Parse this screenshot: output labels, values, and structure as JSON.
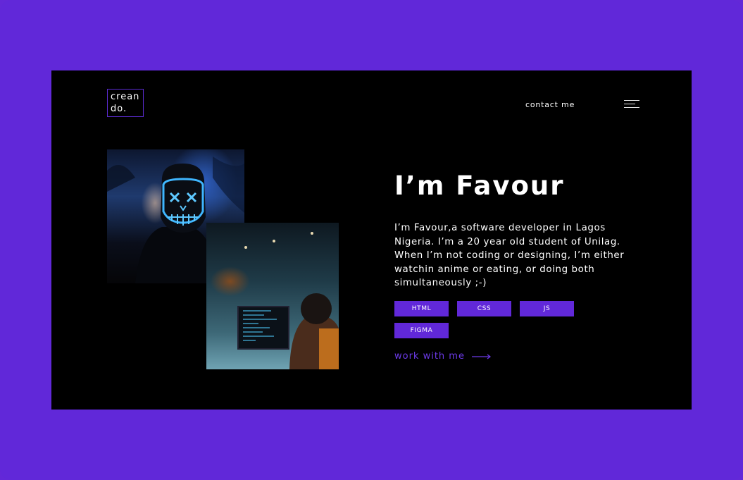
{
  "logo": {
    "line1": "crean",
    "line2": "do."
  },
  "nav": {
    "contact_label": "contact me",
    "menu_icon": "hamburger-menu-icon"
  },
  "hero": {
    "title": "I’m Favour",
    "bio": "I’m Favour,a software developer in Lagos Nigeria. I’m a 20 year old student of Unilag. When I’m not coding or designing, I’m either watchin anime or eating, or doing both simultaneously ;-)",
    "tags": [
      "HTML",
      "CSS",
      "JS",
      "FIGMA"
    ],
    "cta_label": "work with me"
  },
  "colors": {
    "background": "#6128d9",
    "frame": "#000000",
    "accent": "#6128d9",
    "cta_text": "#6c3ae8"
  }
}
